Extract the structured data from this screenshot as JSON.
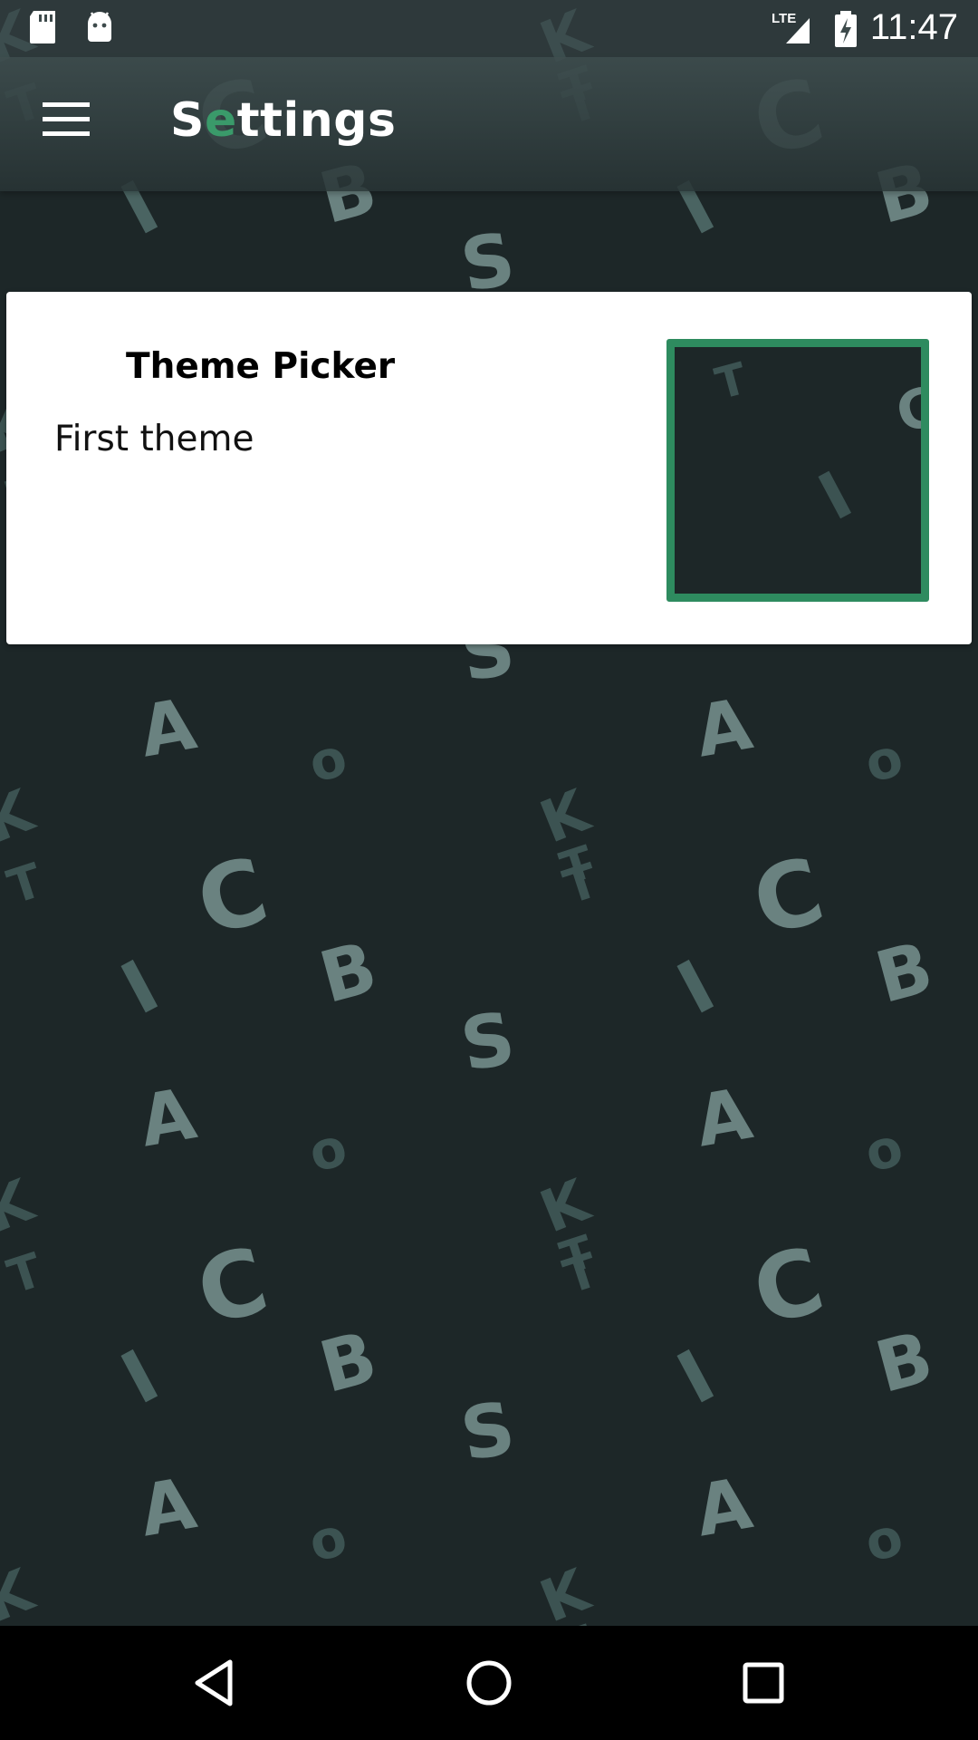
{
  "status_bar": {
    "time": "11:47",
    "icons": [
      "sd-card-icon",
      "android-icon",
      "lte-signal-icon",
      "battery-charging-icon"
    ],
    "network_label": "LTE"
  },
  "app_bar": {
    "title_first": "S",
    "title_accent": "e",
    "title_rest": "ttings",
    "accent_color": "#3a9a6a",
    "menu_icon": "hamburger-menu-icon"
  },
  "card": {
    "title": "Theme Picker",
    "subtitle": "First theme",
    "preview_border_color": "#2e8b5f"
  },
  "nav_bar": {
    "icons": [
      "back-icon",
      "home-icon",
      "recents-icon"
    ]
  },
  "colors": {
    "background": "#1d2728",
    "pattern_letter": "#3c5352",
    "card": "#ffffff",
    "accent": "#2e8b5f"
  }
}
